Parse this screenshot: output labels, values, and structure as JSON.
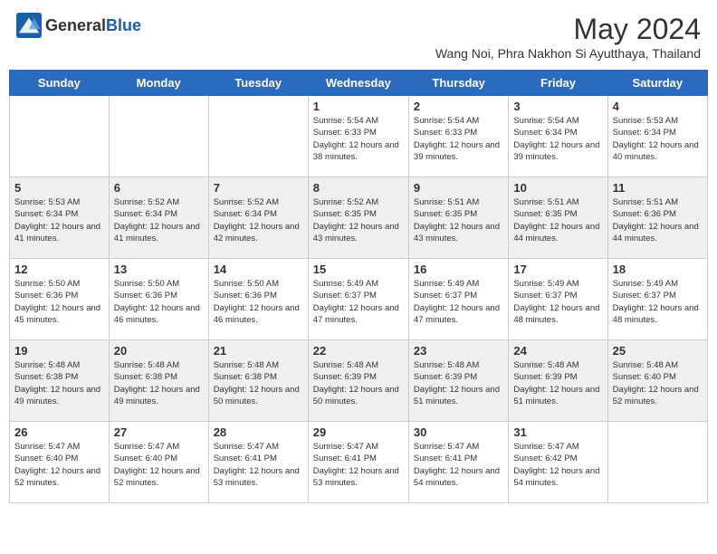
{
  "header": {
    "logo_general": "General",
    "logo_blue": "Blue",
    "month_title": "May 2024",
    "subtitle": "Wang Noi, Phra Nakhon Si Ayutthaya, Thailand"
  },
  "days_of_week": [
    "Sunday",
    "Monday",
    "Tuesday",
    "Wednesday",
    "Thursday",
    "Friday",
    "Saturday"
  ],
  "weeks": [
    [
      {
        "day": "",
        "info": ""
      },
      {
        "day": "",
        "info": ""
      },
      {
        "day": "",
        "info": ""
      },
      {
        "day": "1",
        "info": "Sunrise: 5:54 AM\nSunset: 6:33 PM\nDaylight: 12 hours\nand 38 minutes."
      },
      {
        "day": "2",
        "info": "Sunrise: 5:54 AM\nSunset: 6:33 PM\nDaylight: 12 hours\nand 39 minutes."
      },
      {
        "day": "3",
        "info": "Sunrise: 5:54 AM\nSunset: 6:34 PM\nDaylight: 12 hours\nand 39 minutes."
      },
      {
        "day": "4",
        "info": "Sunrise: 5:53 AM\nSunset: 6:34 PM\nDaylight: 12 hours\nand 40 minutes."
      }
    ],
    [
      {
        "day": "5",
        "info": "Sunrise: 5:53 AM\nSunset: 6:34 PM\nDaylight: 12 hours\nand 41 minutes."
      },
      {
        "day": "6",
        "info": "Sunrise: 5:52 AM\nSunset: 6:34 PM\nDaylight: 12 hours\nand 41 minutes."
      },
      {
        "day": "7",
        "info": "Sunrise: 5:52 AM\nSunset: 6:34 PM\nDaylight: 12 hours\nand 42 minutes."
      },
      {
        "day": "8",
        "info": "Sunrise: 5:52 AM\nSunset: 6:35 PM\nDaylight: 12 hours\nand 43 minutes."
      },
      {
        "day": "9",
        "info": "Sunrise: 5:51 AM\nSunset: 6:35 PM\nDaylight: 12 hours\nand 43 minutes."
      },
      {
        "day": "10",
        "info": "Sunrise: 5:51 AM\nSunset: 6:35 PM\nDaylight: 12 hours\nand 44 minutes."
      },
      {
        "day": "11",
        "info": "Sunrise: 5:51 AM\nSunset: 6:36 PM\nDaylight: 12 hours\nand 44 minutes."
      }
    ],
    [
      {
        "day": "12",
        "info": "Sunrise: 5:50 AM\nSunset: 6:36 PM\nDaylight: 12 hours\nand 45 minutes."
      },
      {
        "day": "13",
        "info": "Sunrise: 5:50 AM\nSunset: 6:36 PM\nDaylight: 12 hours\nand 46 minutes."
      },
      {
        "day": "14",
        "info": "Sunrise: 5:50 AM\nSunset: 6:36 PM\nDaylight: 12 hours\nand 46 minutes."
      },
      {
        "day": "15",
        "info": "Sunrise: 5:49 AM\nSunset: 6:37 PM\nDaylight: 12 hours\nand 47 minutes."
      },
      {
        "day": "16",
        "info": "Sunrise: 5:49 AM\nSunset: 6:37 PM\nDaylight: 12 hours\nand 47 minutes."
      },
      {
        "day": "17",
        "info": "Sunrise: 5:49 AM\nSunset: 6:37 PM\nDaylight: 12 hours\nand 48 minutes."
      },
      {
        "day": "18",
        "info": "Sunrise: 5:49 AM\nSunset: 6:37 PM\nDaylight: 12 hours\nand 48 minutes."
      }
    ],
    [
      {
        "day": "19",
        "info": "Sunrise: 5:48 AM\nSunset: 6:38 PM\nDaylight: 12 hours\nand 49 minutes."
      },
      {
        "day": "20",
        "info": "Sunrise: 5:48 AM\nSunset: 6:38 PM\nDaylight: 12 hours\nand 49 minutes."
      },
      {
        "day": "21",
        "info": "Sunrise: 5:48 AM\nSunset: 6:38 PM\nDaylight: 12 hours\nand 50 minutes."
      },
      {
        "day": "22",
        "info": "Sunrise: 5:48 AM\nSunset: 6:39 PM\nDaylight: 12 hours\nand 50 minutes."
      },
      {
        "day": "23",
        "info": "Sunrise: 5:48 AM\nSunset: 6:39 PM\nDaylight: 12 hours\nand 51 minutes."
      },
      {
        "day": "24",
        "info": "Sunrise: 5:48 AM\nSunset: 6:39 PM\nDaylight: 12 hours\nand 51 minutes."
      },
      {
        "day": "25",
        "info": "Sunrise: 5:48 AM\nSunset: 6:40 PM\nDaylight: 12 hours\nand 52 minutes."
      }
    ],
    [
      {
        "day": "26",
        "info": "Sunrise: 5:47 AM\nSunset: 6:40 PM\nDaylight: 12 hours\nand 52 minutes."
      },
      {
        "day": "27",
        "info": "Sunrise: 5:47 AM\nSunset: 6:40 PM\nDaylight: 12 hours\nand 52 minutes."
      },
      {
        "day": "28",
        "info": "Sunrise: 5:47 AM\nSunset: 6:41 PM\nDaylight: 12 hours\nand 53 minutes."
      },
      {
        "day": "29",
        "info": "Sunrise: 5:47 AM\nSunset: 6:41 PM\nDaylight: 12 hours\nand 53 minutes."
      },
      {
        "day": "30",
        "info": "Sunrise: 5:47 AM\nSunset: 6:41 PM\nDaylight: 12 hours\nand 54 minutes."
      },
      {
        "day": "31",
        "info": "Sunrise: 5:47 AM\nSunset: 6:42 PM\nDaylight: 12 hours\nand 54 minutes."
      },
      {
        "day": "",
        "info": ""
      }
    ]
  ]
}
